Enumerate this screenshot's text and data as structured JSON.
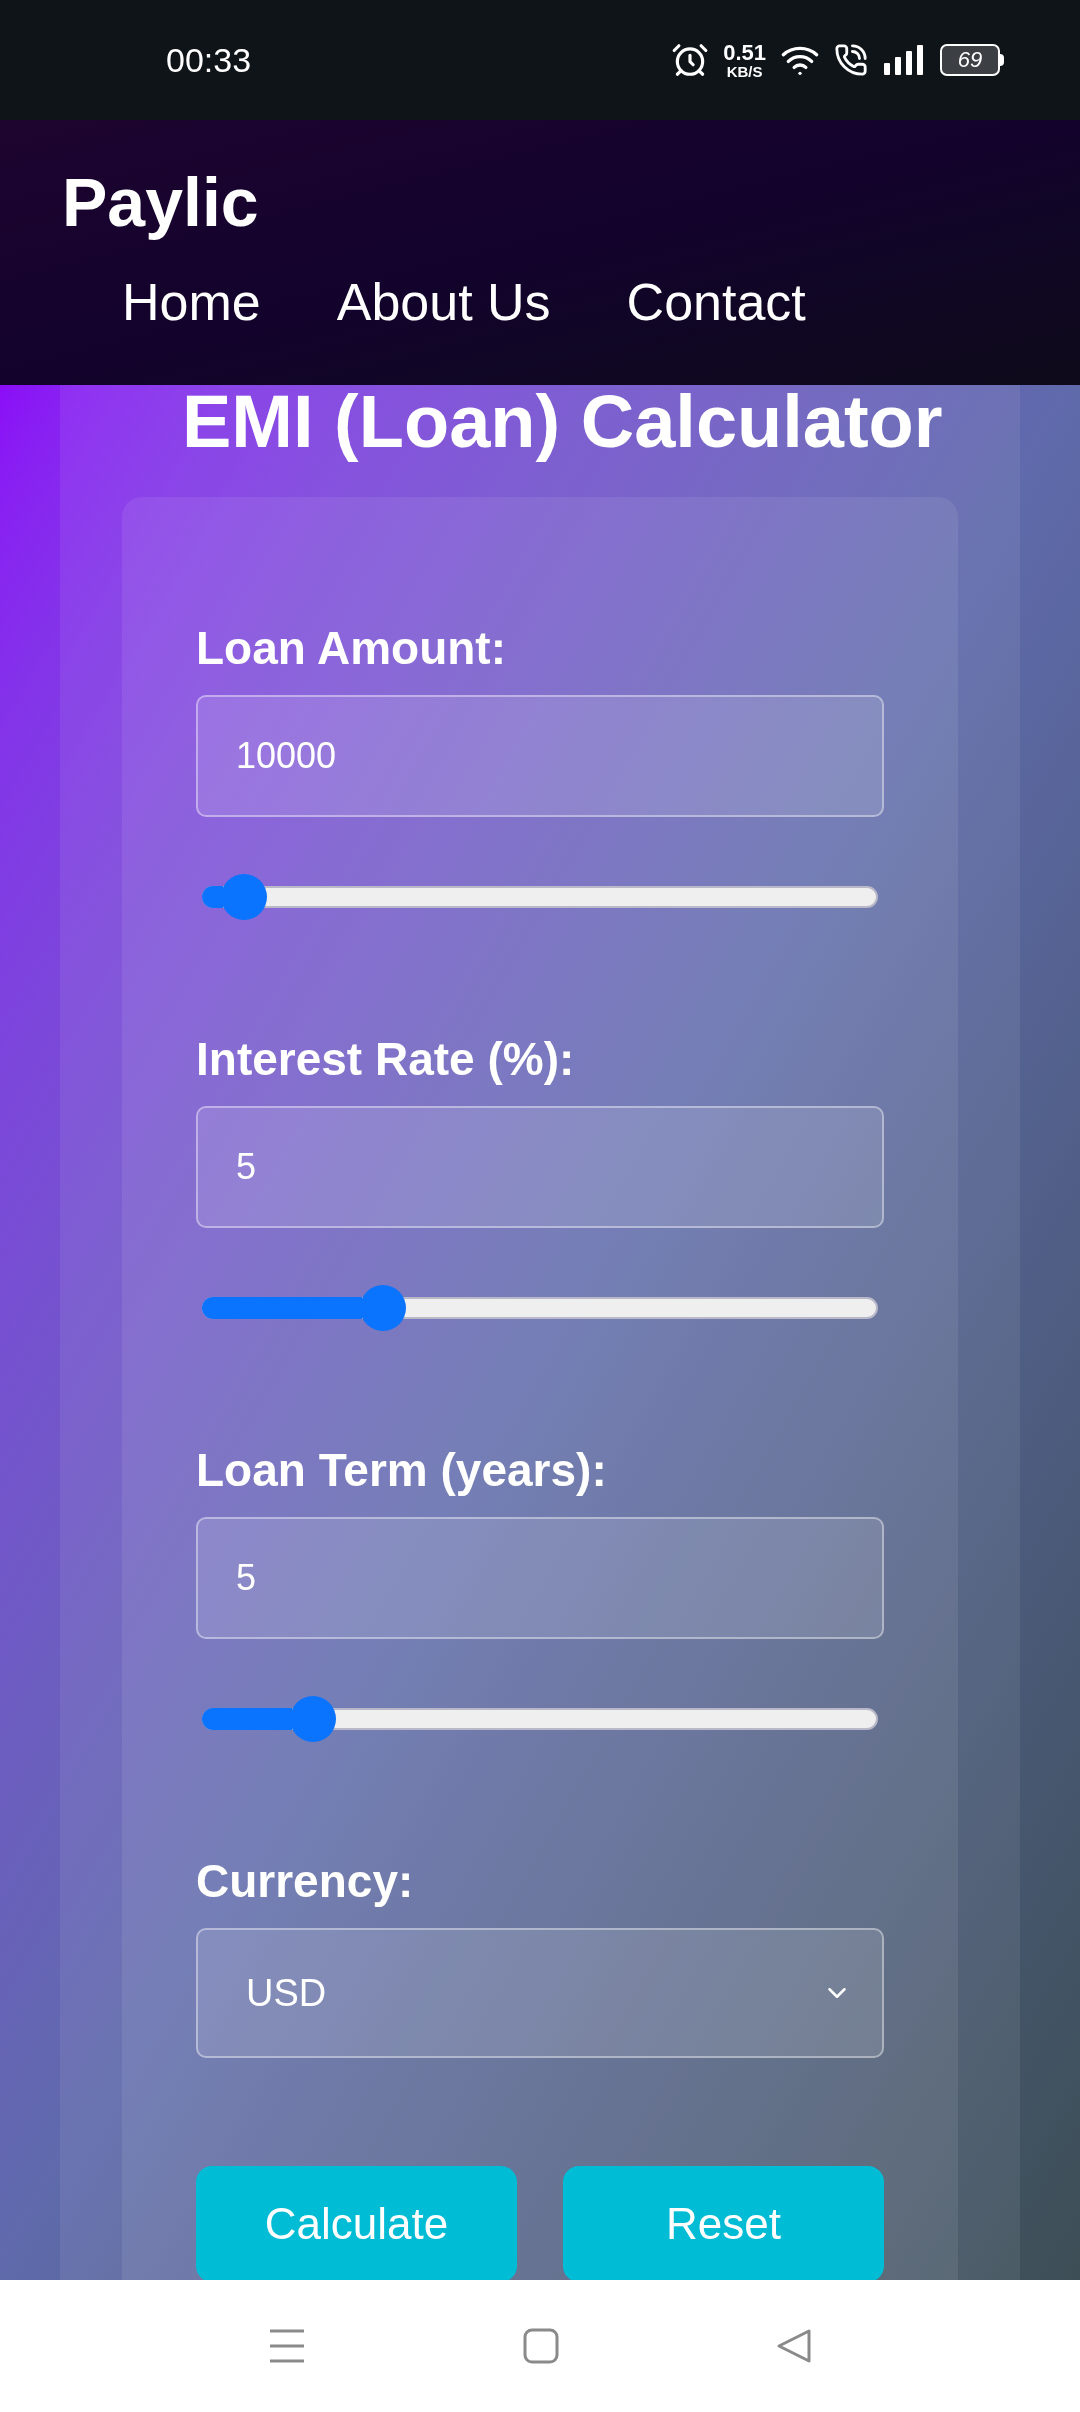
{
  "status_bar": {
    "time": "00:33",
    "speed": "0.51",
    "speed_unit": "KB/S",
    "battery": "69"
  },
  "header": {
    "brand": "Paylic",
    "nav": [
      {
        "label": "Home"
      },
      {
        "label": "About Us"
      },
      {
        "label": "Contact"
      }
    ]
  },
  "title": "EMI (Loan) Calculator",
  "fields": [
    {
      "kind": "slider",
      "label": "Loan Amount:",
      "value": "10000",
      "level": 0.03
    },
    {
      "kind": "slider",
      "label": "Interest Rate (%):",
      "value": "5",
      "level": 0.25
    },
    {
      "kind": "slider",
      "label": "Loan Term (years):",
      "value": "5",
      "level": 0.14
    },
    {
      "kind": "select",
      "label": "Currency:",
      "value": "USD"
    }
  ],
  "buttons": [
    {
      "label": "Calculate"
    },
    {
      "label": "Reset"
    }
  ]
}
